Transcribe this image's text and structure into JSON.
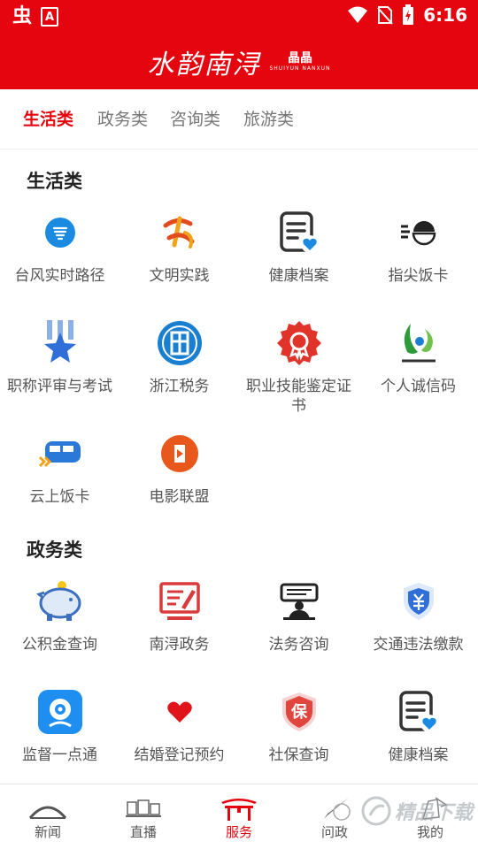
{
  "status_bar": {
    "time": "6:16",
    "app_icon_1": "虫",
    "app_icon_2": "A"
  },
  "header": {
    "logo_main": "水韵南浔",
    "logo_sub_cn": "晶晶",
    "logo_sub_en": "SHUIYUN NANXUN",
    "brand_color": "#e4050f"
  },
  "tabs": [
    {
      "label": "生活类",
      "active": true
    },
    {
      "label": "政务类",
      "active": false
    },
    {
      "label": "咨询类",
      "active": false
    },
    {
      "label": "旅游类",
      "active": false
    }
  ],
  "sections": [
    {
      "title": "生活类",
      "items": [
        {
          "label": "台风实时路径",
          "icon": "typhoon-icon"
        },
        {
          "label": "文明实践",
          "icon": "civilization-icon"
        },
        {
          "label": "健康档案",
          "icon": "health-record-icon"
        },
        {
          "label": "指尖饭卡",
          "icon": "meal-card-icon"
        },
        {
          "label": "职称评审与考试",
          "icon": "title-review-icon"
        },
        {
          "label": "浙江税务",
          "icon": "tax-icon"
        },
        {
          "label": "职业技能鉴定证书",
          "icon": "certificate-icon"
        },
        {
          "label": "个人诚信码",
          "icon": "credit-code-icon"
        },
        {
          "label": "云上饭卡",
          "icon": "cloud-meal-card-icon"
        },
        {
          "label": "电影联盟",
          "icon": "film-icon"
        }
      ]
    },
    {
      "title": "政务类",
      "items": [
        {
          "label": "公积金查询",
          "icon": "piggy-bank-icon"
        },
        {
          "label": "南浔政务",
          "icon": "government-affairs-icon"
        },
        {
          "label": "法务咨询",
          "icon": "legal-consult-icon"
        },
        {
          "label": "交通违法缴款",
          "icon": "traffic-fine-icon"
        },
        {
          "label": "监督一点通",
          "icon": "supervision-camera-icon"
        },
        {
          "label": "结婚登记预约",
          "icon": "heart-icon"
        },
        {
          "label": "社保查询",
          "icon": "social-security-icon"
        },
        {
          "label": "健康档案",
          "icon": "health-record-icon"
        }
      ]
    }
  ],
  "bottom_nav": [
    {
      "label": "新闻",
      "icon": "bridge-icon",
      "active": false
    },
    {
      "label": "直播",
      "icon": "live-icon",
      "active": false
    },
    {
      "label": "服务",
      "icon": "gate-icon",
      "active": true
    },
    {
      "label": "问政",
      "icon": "brush-icon",
      "active": false
    },
    {
      "label": "我的",
      "icon": "profile-icon",
      "active": false
    }
  ],
  "watermark": {
    "text": "精品下载"
  }
}
